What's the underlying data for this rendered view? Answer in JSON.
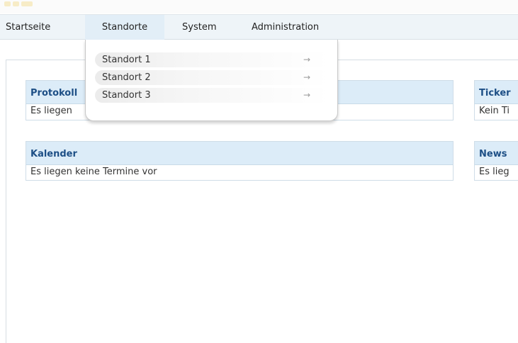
{
  "nav": {
    "items": [
      {
        "label": "Startseite"
      },
      {
        "label": "Standorte"
      },
      {
        "label": "System"
      },
      {
        "label": "Administration"
      }
    ]
  },
  "dropdown": {
    "items": [
      {
        "label": "Standort 1",
        "arrow": "→"
      },
      {
        "label": "Standort 2",
        "arrow": "→"
      },
      {
        "label": "Standort 3",
        "arrow": "→"
      }
    ]
  },
  "panels": {
    "protokoll": {
      "title": "Protokoll",
      "body": "Es liegen"
    },
    "ticker": {
      "title": "Ticker",
      "body": "Kein Ti"
    },
    "kalender": {
      "title": "Kalender",
      "body": "Es liegen keine Termine vor"
    },
    "news": {
      "title": "News",
      "body": "Es lieg"
    }
  },
  "colors": {
    "panel_header_bg": "#dcecf8",
    "panel_title": "#1d4f86",
    "navbar_bg": "#eef4f8"
  }
}
